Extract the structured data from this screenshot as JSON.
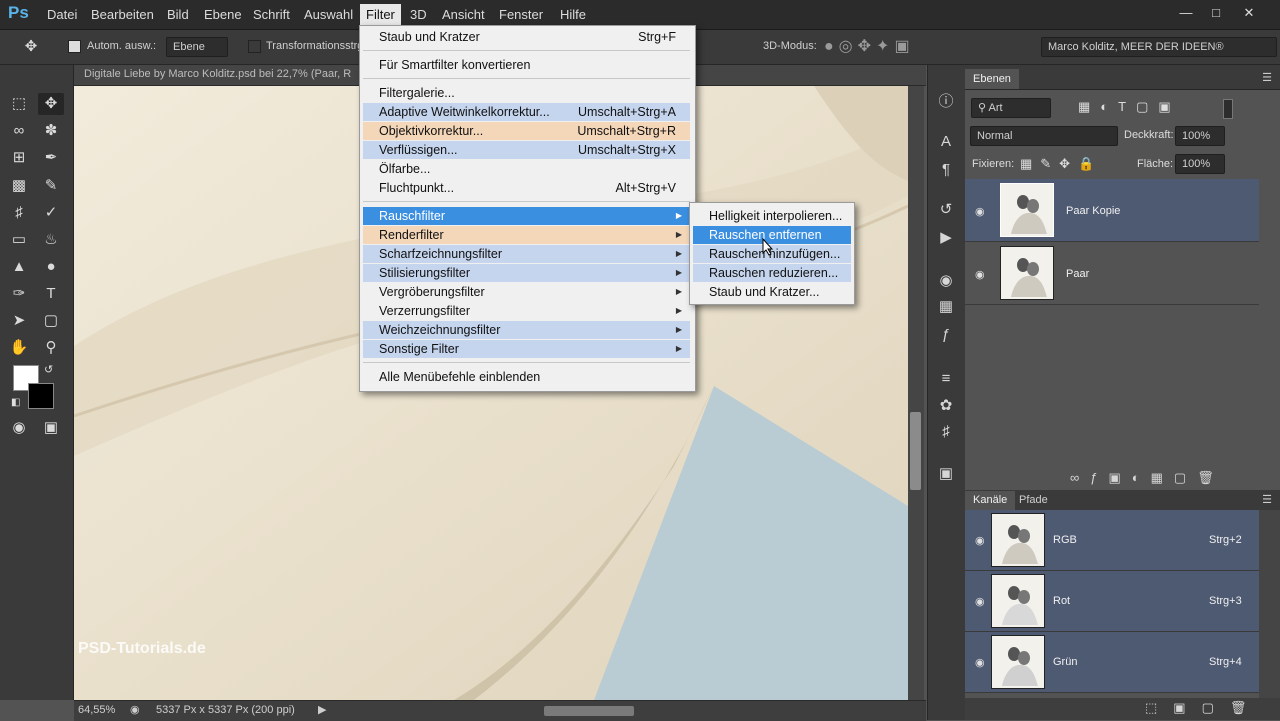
{
  "app": {
    "logo": "Ps"
  },
  "menubar": {
    "items": [
      "Datei",
      "Bearbeiten",
      "Bild",
      "Ebene",
      "Schrift",
      "Auswahl",
      "Filter",
      "3D",
      "Ansicht",
      "Fenster",
      "Hilfe"
    ],
    "active": "Filter"
  },
  "options": {
    "auto_select": "Autom. ausw.:",
    "auto_select_target": "Ebene",
    "transform": "Transformationsstrg.",
    "mode3d": "3D-Modus:",
    "workspace": "Marco Kolditz, MEER DER IDEEN®"
  },
  "document": {
    "title": "Digitale Liebe by Marco Kolditz.psd bei 22,7% (Paar, R",
    "zoom": "64,55%",
    "docsize": "5337 Px x 5337 Px (200 ppi)"
  },
  "filter_menu": {
    "last_filter": {
      "label": "Staub und Kratzer",
      "shortcut": "Strg+F"
    },
    "smart": "Für Smartfilter konvertieren",
    "items_a": [
      {
        "label": "Filtergalerie...",
        "shortcut": ""
      },
      {
        "label": "Adaptive Weitwinkelkorrektur...",
        "shortcut": "Umschalt+Strg+A"
      },
      {
        "label": "Objektivkorrektur...",
        "shortcut": "Umschalt+Strg+R"
      },
      {
        "label": "Verflüssigen...",
        "shortcut": "Umschalt+Strg+X"
      },
      {
        "label": "Ölfarbe...",
        "shortcut": ""
      },
      {
        "label": "Fluchtpunkt...",
        "shortcut": "Alt+Strg+V"
      }
    ],
    "submenus": [
      "Rauschfilter",
      "Renderfilter",
      "Scharfzeichnungsfilter",
      "Stilisierungsfilter",
      "Vergröberungsfilter",
      "Verzerrungsfilter",
      "Weichzeichnungsfilter",
      "Sonstige Filter"
    ],
    "show_all": "Alle Menübefehle einblenden"
  },
  "noise_submenu": {
    "items": [
      "Helligkeit interpolieren...",
      "Rauschen entfernen",
      "Rauschen hinzufügen...",
      "Rauschen reduzieren...",
      "Staub und Kratzer..."
    ]
  },
  "layers": {
    "tab": "Ebenen",
    "filter_kind": "Art",
    "blend": "Normal",
    "opacity_label": "Deckkraft:",
    "opacity": "100%",
    "lock_label": "Fixieren:",
    "fill_label": "Fläche:",
    "fill": "100%",
    "rows": [
      {
        "name": "Paar Kopie"
      },
      {
        "name": "Paar"
      }
    ]
  },
  "channels": {
    "tabs": [
      "Kanäle",
      "Pfade"
    ],
    "rows": [
      {
        "name": "RGB",
        "shortcut": "Strg+2"
      },
      {
        "name": "Rot",
        "shortcut": "Strg+3"
      },
      {
        "name": "Grün",
        "shortcut": "Strg+4"
      }
    ]
  },
  "watermark": "PSD-Tutorials.de"
}
